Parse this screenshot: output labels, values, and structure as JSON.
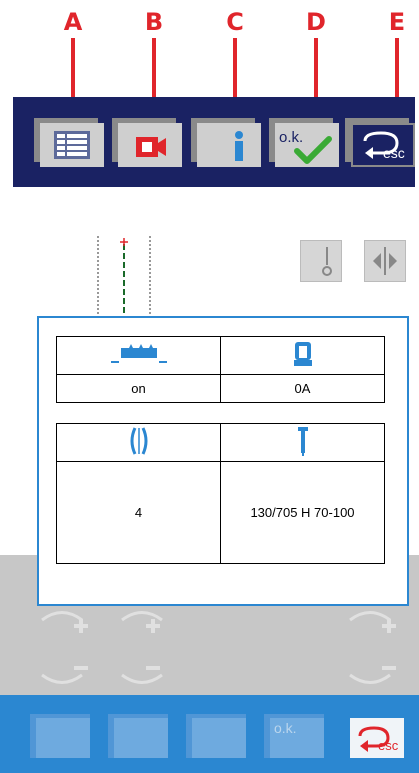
{
  "callouts": [
    "A",
    "B",
    "C",
    "D",
    "E"
  ],
  "top_toolbar": {
    "buttons": [
      {
        "label": "",
        "icon": "list-icon"
      },
      {
        "label": "",
        "icon": "camera-icon"
      },
      {
        "label": "",
        "icon": "info-icon"
      },
      {
        "label": "o.k.",
        "icon": "ok-check-icon"
      },
      {
        "label": "esc",
        "icon": "esc-return-icon"
      }
    ]
  },
  "info_dialog": {
    "feed_dogs_value": "on",
    "presser_foot_value": "0A",
    "stitch_width_value": "4",
    "needle_value": "130/705 H 70-100"
  },
  "bottom_toolbar": {
    "ok_label": "o.k.",
    "esc_label": "esc"
  },
  "colors": {
    "callout_red": "#e0252b",
    "toolbar_navy": "#1a2263",
    "accent_blue": "#2b87d1",
    "check_green": "#3aaa35"
  }
}
